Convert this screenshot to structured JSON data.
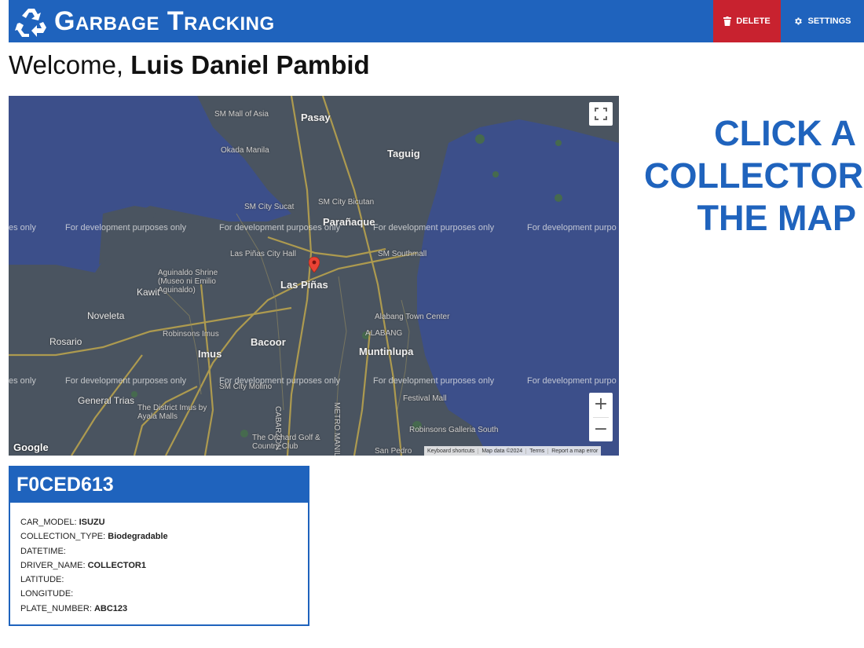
{
  "header": {
    "title": "Garbage Tracking",
    "delete_label": "DELETE",
    "settings_label": "SETTINGS",
    "logo_icon": "recycle-icon",
    "colors": {
      "primary": "#1f63bd",
      "danger": "#c8222f"
    }
  },
  "welcome": {
    "prefix": "Welcome, ",
    "user_name": "Luis Daniel Pambid"
  },
  "map": {
    "labels": {
      "pasay": "Pasay",
      "taguig": "Taguig",
      "paranaque": "Parañaque",
      "las_pinas": "Las Piñas",
      "bacoor": "Bacoor",
      "imus": "Imus",
      "muntinlupa": "Muntinlupa",
      "kawit": "Kawit",
      "noveleta": "Noveleta",
      "rosario": "Rosario",
      "general_trias": "General Trias",
      "cabarzon": "CABARZON",
      "metro_manila": "METRO MANILA",
      "alabang": "ALABANG",
      "san_pedro": "San Pedro"
    },
    "pois": {
      "sm_mall_of_asia": "SM Mall of Asia",
      "okada_manila": "Okada Manila",
      "sm_city_bicutan": "SM City Bicutan",
      "sm_city_sucat": "SM City Sucat",
      "las_pinas_city_hall": "Las Piñas City Hall",
      "aguinaldo_shrine": "Aguinaldo Shrine (Museo ni Emilio Aguinaldo)",
      "robinsons_imus": "Robinsons Imus",
      "sm_city_molino": "SM City Molino",
      "the_district_imus": "The District Imus by Ayala Malls",
      "the_orchard": "The Orchard Golf & Country Club",
      "sm_southmall": "SM Southmall",
      "alabang_town_center": "Alabang Town Center",
      "festival_mall": "Festival Mall",
      "robinsons_galleria_south": "Robinsons Galleria South"
    },
    "watermark": "For development purposes only",
    "watermark_left_fragment": "es only",
    "watermark_right_fragment": "For development purpo",
    "google_logo": "Google",
    "attribution": {
      "keyboard": "Keyboard shortcuts",
      "map_data": "Map data ©2024",
      "terms": "Terms",
      "report": "Report a map error"
    },
    "zoom_in": "+",
    "zoom_out": "−",
    "colors": {
      "water": "#3c4f8a",
      "land": "#4a5460",
      "road": "#b8a24e"
    }
  },
  "prompt": {
    "line1": "CLICK A",
    "line2": "COLLECTOR",
    "line3": "THE MAP"
  },
  "card": {
    "title": "F0CED613",
    "fields": [
      {
        "key": "CAR_MODEL: ",
        "value": "ISUZU"
      },
      {
        "key": "COLLECTION_TYPE: ",
        "value": "Biodegradable"
      },
      {
        "key": "DATETIME:",
        "value": ""
      },
      {
        "key": "DRIVER_NAME: ",
        "value": "COLLECTOR1"
      },
      {
        "key": "LATITUDE:",
        "value": ""
      },
      {
        "key": "LONGITUDE:",
        "value": ""
      },
      {
        "key": "PLATE_NUMBER: ",
        "value": "ABC123"
      }
    ]
  }
}
